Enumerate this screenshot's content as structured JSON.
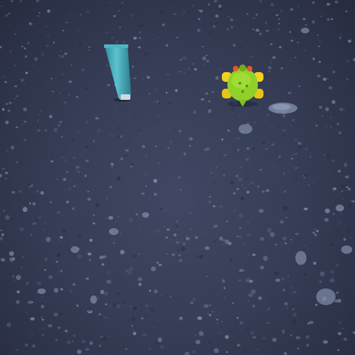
{
  "scene": {
    "ground_color": "#3a4157",
    "objects": [
      {
        "name": "tube",
        "color": "#3fa8b8"
      },
      {
        "name": "toy-turtle",
        "color": "#8fd12a",
        "accent_color": "#f2d21e"
      }
    ]
  }
}
